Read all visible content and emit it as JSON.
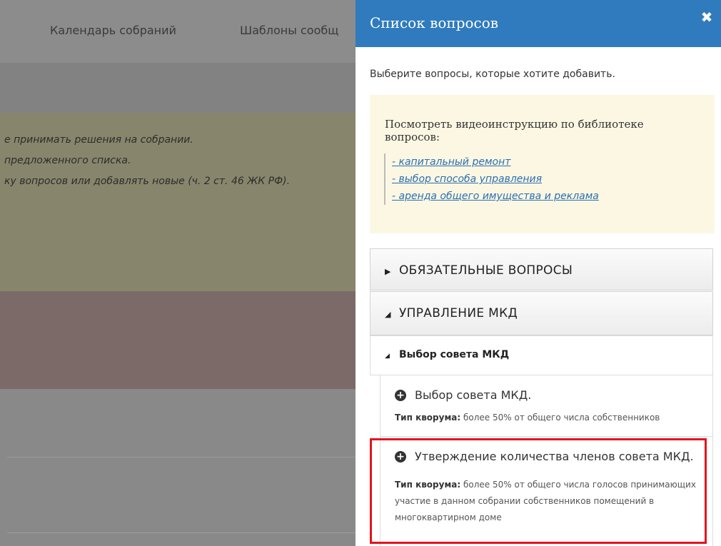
{
  "background": {
    "nav": [
      "Календарь собраний",
      "Шаблоны сообщ"
    ],
    "info_lines": [
      "е принимать решения на собрании.",
      "предложенного списка.",
      "ку вопросов или добавлять новые (ч. 2 ст. 46 ЖК РФ)."
    ]
  },
  "panel": {
    "title": "Список вопросов",
    "close_icon": "close-icon",
    "intro": "Выберите вопросы, которые хотите добавить.",
    "video": {
      "title": "Посмотреть видеоинструкцию по библиотеке вопросов:",
      "links": [
        "- капитальный ремонт",
        "- выбор способа управления",
        "- аренда общего имущества и реклама"
      ]
    },
    "sections": [
      {
        "label": "ОБЯЗАТЕЛЬНЫЕ ВОПРОСЫ",
        "expanded": false
      },
      {
        "label": "УПРАВЛЕНИЕ МКД",
        "expanded": true
      }
    ],
    "subsection": {
      "label": "Выбор совета МКД",
      "expanded": true
    },
    "questions": [
      {
        "title": "Выбор совета МКД.",
        "quorum_label": "Тип кворума:",
        "quorum_text": "более 50% от общего числа собственников"
      },
      {
        "title": "Утверждение количества членов совета МКД.",
        "quorum_label": "Тип кворума:",
        "quorum_text": "более 50% от общего числа голосов принимающих участие в данном собрании собственников помещений в многоквартирном доме"
      }
    ],
    "highlight_color": "#e5131d",
    "header_color": "#2f7bbd"
  }
}
